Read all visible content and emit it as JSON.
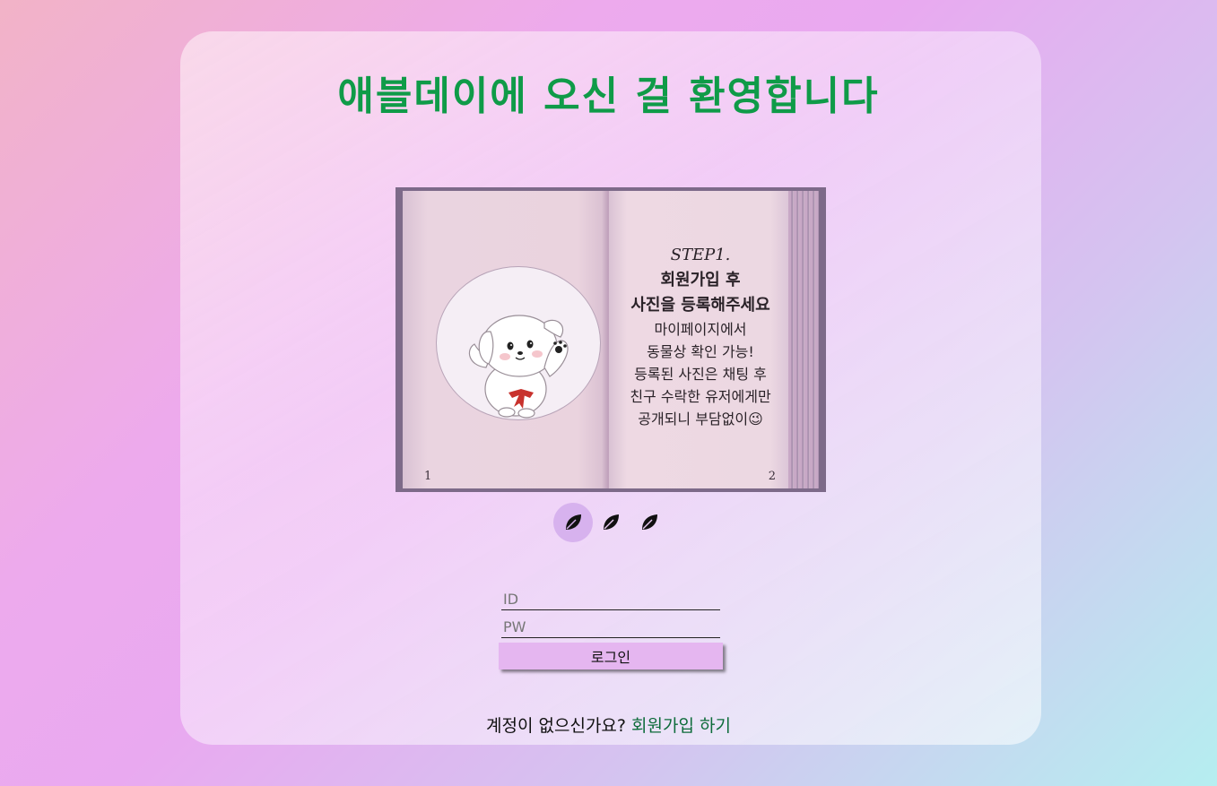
{
  "title": "애블데이에 오신 걸 환영합니다",
  "slide": {
    "step": "STEP1.",
    "heading_line1": "회원가입 후",
    "heading_line2": "사진을 등록해주세요",
    "body": [
      "마이페이지에서",
      "동물상 확인 가능!",
      "등록된 사진은 채팅 후",
      "친구 수락한 유저에게만",
      "공개되니 부담없이😉"
    ],
    "page_left_number": "1",
    "page_right_number": "2"
  },
  "carousel": {
    "indicator_count": 3,
    "active_index": 0,
    "icon": "leaf-icon"
  },
  "login": {
    "id_placeholder": "ID",
    "pw_placeholder": "PW",
    "button_label": "로그인"
  },
  "signup": {
    "prompt": "계정이 없으신가요?",
    "link_label": "회원가입 하기"
  },
  "colors": {
    "title_green": "#0f9b48",
    "link_green": "#0d6b3a",
    "button_bg": "#e5b6f0",
    "active_dot_bg": "#d7b2ee"
  }
}
